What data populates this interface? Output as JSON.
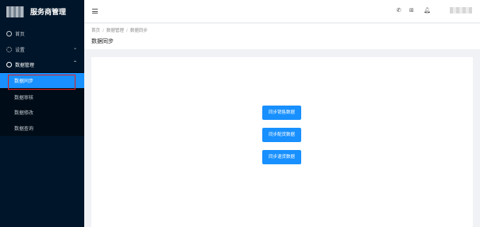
{
  "app": {
    "title": "服务商管理"
  },
  "sidebar": {
    "items": [
      {
        "label": "首页",
        "icon": "home-icon"
      },
      {
        "label": "设置",
        "icon": "gear-icon",
        "arrow": "⌄"
      },
      {
        "label": "数据管理",
        "icon": "data-icon",
        "arrow": "⌃"
      }
    ],
    "subitems": [
      {
        "label": "数据同步",
        "active": true
      },
      {
        "label": "数据审核"
      },
      {
        "label": "数据修改"
      },
      {
        "label": "数据查询"
      }
    ]
  },
  "header": {
    "icons": [
      "phone-icon",
      "grid-icon",
      "bell-icon"
    ]
  },
  "breadcrumb": {
    "items": [
      "首页",
      "数据管理",
      "数据同步"
    ],
    "separator": "/"
  },
  "page": {
    "title": "数据同步"
  },
  "actions": {
    "sync_sales": "同步销售数据",
    "sync_config": "同步配货数据",
    "sync_returns": "同步退货数据"
  },
  "colors": {
    "sidebar_bg": "#001529",
    "accent": "#1890ff",
    "highlight_border": "#e02020"
  }
}
